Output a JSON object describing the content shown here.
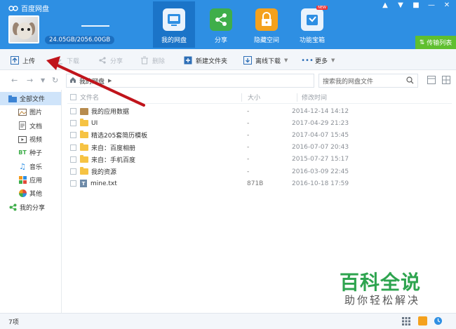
{
  "app": {
    "title": "百度网盘"
  },
  "account": {
    "quota": "24.05GB/2056.00GB"
  },
  "nav": [
    {
      "label": "我的网盘",
      "icon": "drive-icon",
      "active": true
    },
    {
      "label": "分享",
      "icon": "share-icon"
    },
    {
      "label": "隐藏空间",
      "icon": "lock-icon"
    },
    {
      "label": "功能宝箱",
      "icon": "toolbox-icon",
      "badge": "NEW"
    }
  ],
  "transfer_button": "传输列表",
  "toolbar": {
    "upload": "上传",
    "download": "下载",
    "share": "分享",
    "delete": "删除",
    "new_folder": "新建文件夹",
    "offline_download": "离线下载",
    "more": "更多"
  },
  "address": {
    "path": "我的网盘",
    "search_placeholder": "搜索我的网盘文件"
  },
  "sidebar": {
    "items": [
      {
        "label": "全部文件",
        "icon": "folder-icon",
        "active": true
      },
      {
        "label": "图片",
        "icon": "image-icon"
      },
      {
        "label": "文档",
        "icon": "document-icon"
      },
      {
        "label": "视频",
        "icon": "video-icon"
      },
      {
        "label": "种子",
        "icon": "bt-icon"
      },
      {
        "label": "音乐",
        "icon": "music-icon"
      },
      {
        "label": "应用",
        "icon": "app-icon"
      },
      {
        "label": "其他",
        "icon": "other-icon"
      },
      {
        "label": "我的分享",
        "icon": "share-icon"
      }
    ]
  },
  "file_list": {
    "columns": {
      "name": "文件名",
      "size": "大小",
      "time": "修改时间"
    },
    "rows": [
      {
        "name": "我的应用数据",
        "type": "app-folder",
        "size": "-",
        "time": "2014-12-14 14:12"
      },
      {
        "name": "UI",
        "type": "folder",
        "size": "-",
        "time": "2017-04-29 21:23"
      },
      {
        "name": "精选205套简历模板",
        "type": "folder",
        "size": "-",
        "time": "2017-04-07 15:45"
      },
      {
        "name": "来自：百度相册",
        "type": "folder",
        "size": "-",
        "time": "2016-07-07 20:43"
      },
      {
        "name": "来自：手机百度",
        "type": "folder",
        "size": "-",
        "time": "2015-07-27 15:17"
      },
      {
        "name": "我的资源",
        "type": "folder",
        "size": "-",
        "time": "2016-03-09 22:45"
      },
      {
        "name": "mine.txt",
        "type": "txt",
        "size": "871B",
        "time": "2016-10-18 17:59"
      }
    ]
  },
  "status": {
    "count": "7项"
  },
  "watermark": {
    "title": "百科全说",
    "subtitle": "助你轻松解决"
  },
  "colors": {
    "header": "#2e8fe3",
    "active_tab": "#1b74c8",
    "transfer": "#5fbf2f",
    "annotation_arrow": "#c0141b"
  }
}
